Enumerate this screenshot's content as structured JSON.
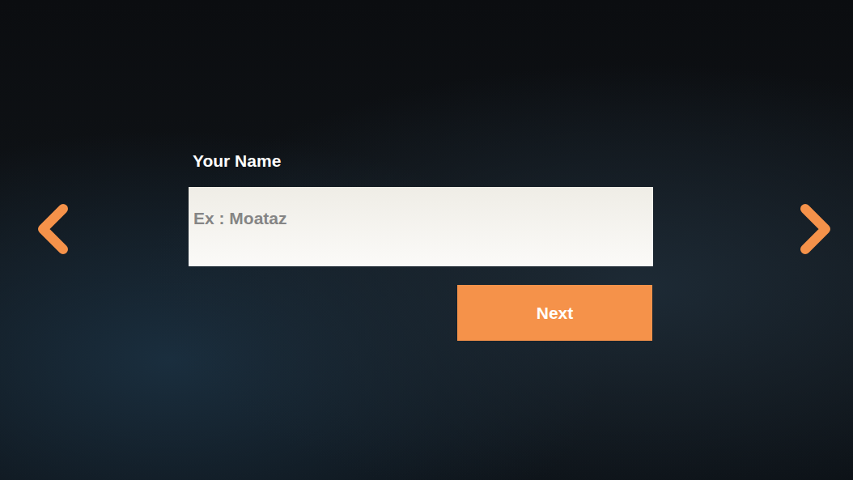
{
  "form": {
    "label": "Your Name",
    "placeholder": "Ex : Moataz",
    "value": "",
    "submit": "Next"
  },
  "navigation": {
    "previous_enabled": true,
    "next_enabled": true
  }
}
